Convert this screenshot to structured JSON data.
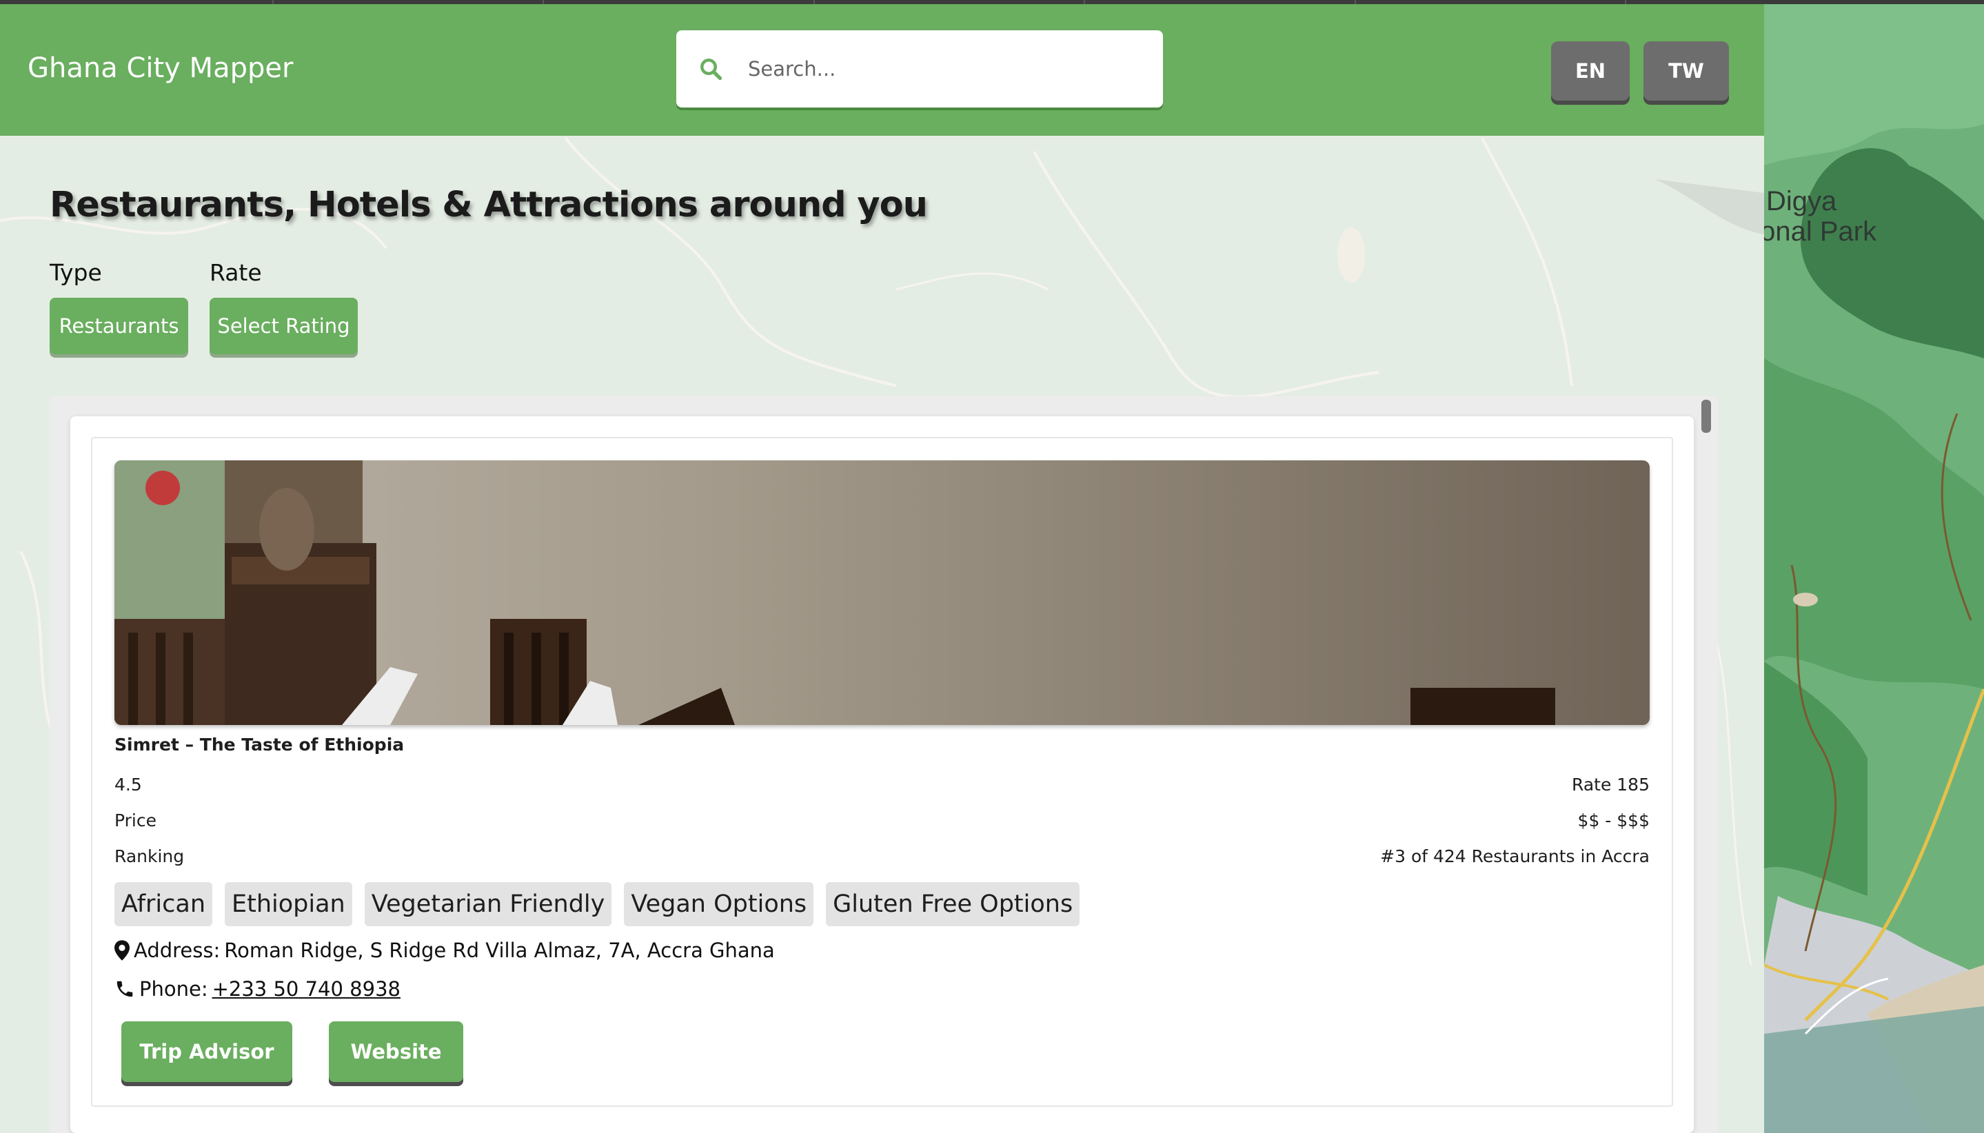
{
  "header": {
    "app_title": "Ghana City Mapper",
    "search_placeholder": "Search...",
    "languages": [
      "EN",
      "TW"
    ]
  },
  "map": {
    "label": "Digya National Park",
    "label_lines": [
      "Digya",
      "National Park"
    ]
  },
  "page": {
    "title": "Restaurants, Hotels & Attractions around you"
  },
  "filters": {
    "type_label": "Type",
    "type_value": "Restaurants",
    "rate_label": "Rate",
    "rate_value": "Select Rating"
  },
  "listing": {
    "name": "Simret – The Taste of Ethiopia",
    "rating": "4.5",
    "rate_text": "Rate 185",
    "price_label": "Price",
    "price_value": "$$ - $$$",
    "ranking_label": "Ranking",
    "ranking_value": "#3 of 424 Restaurants in Accra",
    "tags": [
      "African",
      "Ethiopian",
      "Vegetarian Friendly",
      "Vegan Options",
      "Gluten Free Options"
    ],
    "address_prefix": "Address:",
    "address": "Roman Ridge, S Ridge Rd Villa Almaz, 7A, Accra Ghana",
    "phone_prefix": "Phone:",
    "phone": "+233 50 740 8938",
    "trip_advisor_label": "Trip Advisor",
    "website_label": "Website"
  },
  "colors": {
    "header_green": "#6aae5f",
    "button_gray": "#6d6d6d",
    "map_green": "#6fa978"
  }
}
